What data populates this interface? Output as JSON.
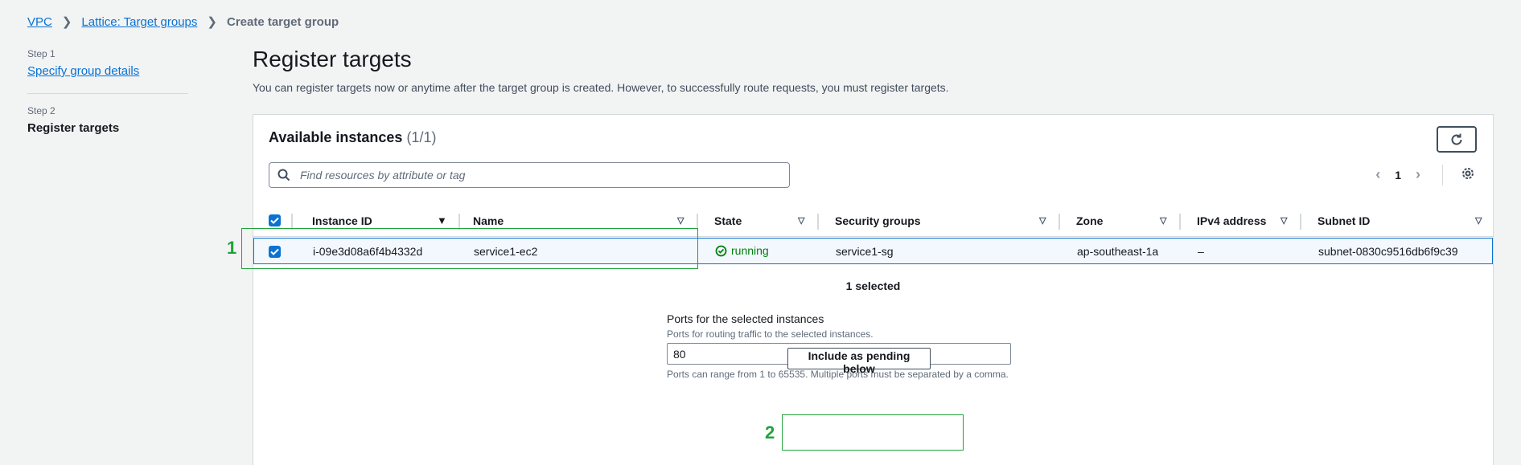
{
  "breadcrumb": {
    "items": [
      "VPC",
      "Lattice: Target groups"
    ],
    "current": "Create target group"
  },
  "steps": [
    {
      "label": "Step 1",
      "title": "Specify group details"
    },
    {
      "label": "Step 2",
      "title": "Register targets"
    }
  ],
  "page": {
    "title": "Register targets",
    "description": "You can register targets now or anytime after the target group is created. However, to successfully route requests, you must register targets."
  },
  "panel": {
    "title": "Available instances",
    "count": "(1/1)",
    "search_placeholder": "Find resources by attribute or tag",
    "page_number": "1",
    "columns": [
      "Instance ID",
      "Name",
      "State",
      "Security groups",
      "Zone",
      "IPv4 address",
      "Subnet ID"
    ],
    "rows": [
      {
        "instance_id": "i-09e3d08a6f4b4332d",
        "name": "service1-ec2",
        "state": "running",
        "security_groups": "service1-sg",
        "zone": "ap-southeast-1a",
        "ipv4": "–",
        "subnet_id": "subnet-0830c9516db6f9c39"
      }
    ],
    "selected_text": "1 selected"
  },
  "ports": {
    "label": "Ports for the selected instances",
    "description": "Ports for routing traffic to the selected instances.",
    "value": "80",
    "hint": "Ports can range from 1 to 65535. Multiple ports must be separated by a comma."
  },
  "include_button": "Include as pending below",
  "annotations": [
    "1",
    "2"
  ],
  "colors": {
    "link": "#0972d3",
    "success": "#037f0c",
    "annotation": "#1fa33a"
  }
}
